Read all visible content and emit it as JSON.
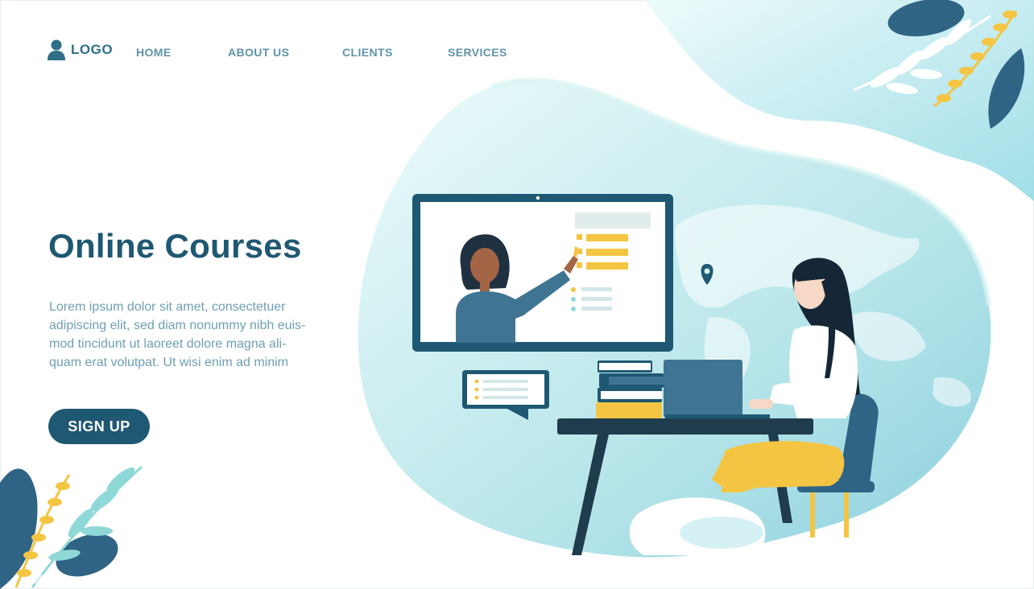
{
  "header": {
    "logo_label": "LOGO",
    "nav_items": [
      "HOME",
      "ABOUT US",
      "CLIENTS",
      "SERVICES"
    ]
  },
  "hero": {
    "title": "Online Courses",
    "body_lines": [
      "Lorem ipsum dolor sit amet, consectetuer",
      "adipiscing elit, sed diam nonummy nibh euis-",
      "mod tincidunt ut laoreet dolore magna ali-",
      "quam erat volutpat. Ut wisi enim ad minim"
    ],
    "cta_label": "SIGN UP"
  },
  "icons": [
    "user-icon",
    "location-pin-icon"
  ],
  "colors": {
    "primary": "#1f5872",
    "nav_text": "#5f93a8",
    "body_text": "#6f9fb3",
    "accent_yellow": "#f4c542",
    "accent_teal": "#8fd8d8"
  }
}
